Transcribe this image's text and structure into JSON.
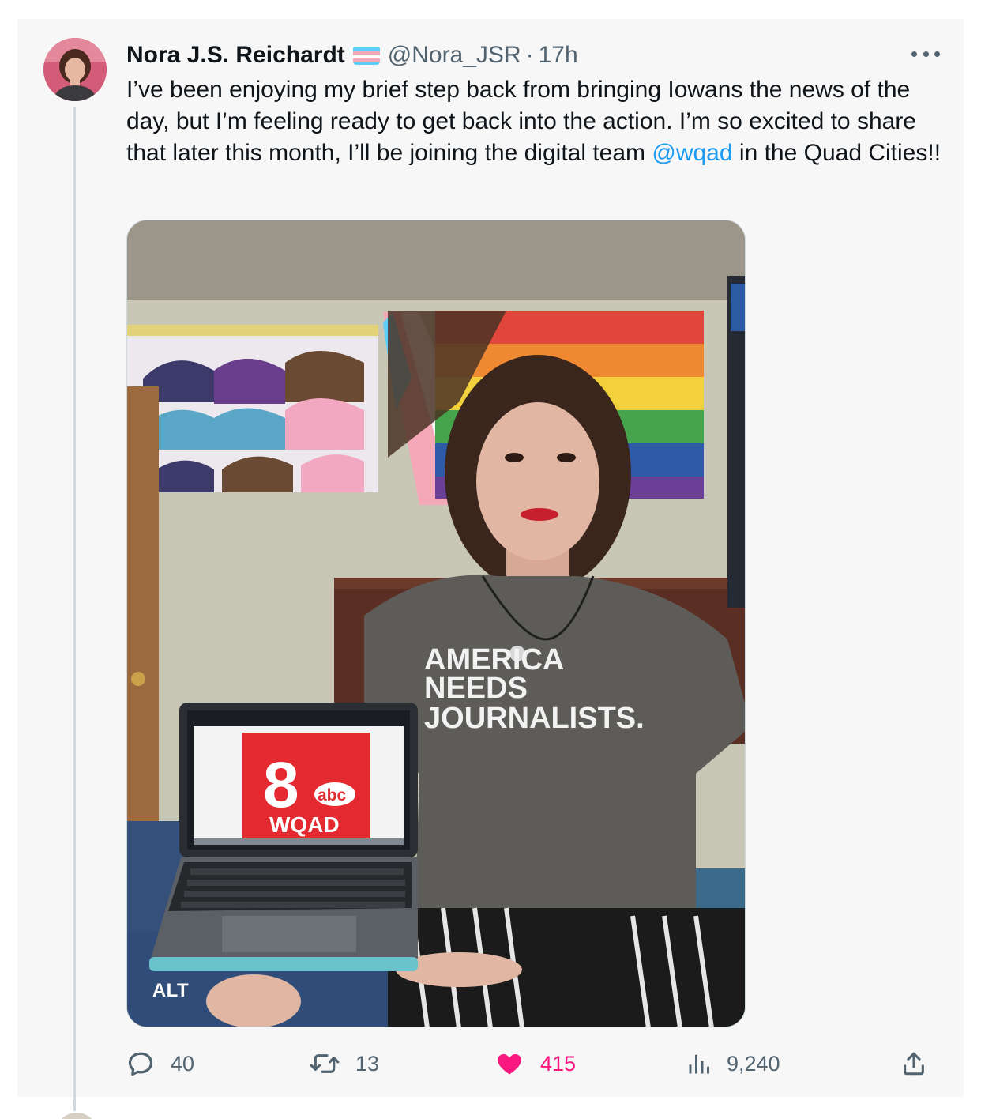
{
  "tweet": {
    "author": {
      "display_name": "Nora J.S. Reichardt",
      "handle": "@Nora_JSR",
      "flag": "transgender-flag"
    },
    "separator": "·",
    "time": "17h",
    "text_before": "I’ve been enjoying my brief step back from bringing Iowans the news of the day, but I’m feeling ready to get back into the action. I’m so excited to share that later this month, I’ll be joining the digital team ",
    "mention": "@wqad",
    "text_after": " in the Quad Cities!!",
    "media": {
      "alt_label": "ALT",
      "shirt_text": [
        "AMERICA",
        "NEEDS",
        "JOURNALISTS."
      ],
      "screen_logo_number": "8",
      "screen_logo_network": "abc",
      "screen_logo_station": "WQAD"
    },
    "stats": {
      "replies": "40",
      "retweets": "13",
      "likes": "415",
      "views": "9,240"
    }
  },
  "colors": {
    "accent": "#1d9bf0",
    "like": "#f91880",
    "muted": "#536471",
    "text": "#0f1419",
    "card_bg": "#f7f7f8"
  },
  "icons": [
    "more-icon",
    "reply-icon",
    "retweet-icon",
    "heart-icon",
    "views-icon",
    "share-icon"
  ]
}
